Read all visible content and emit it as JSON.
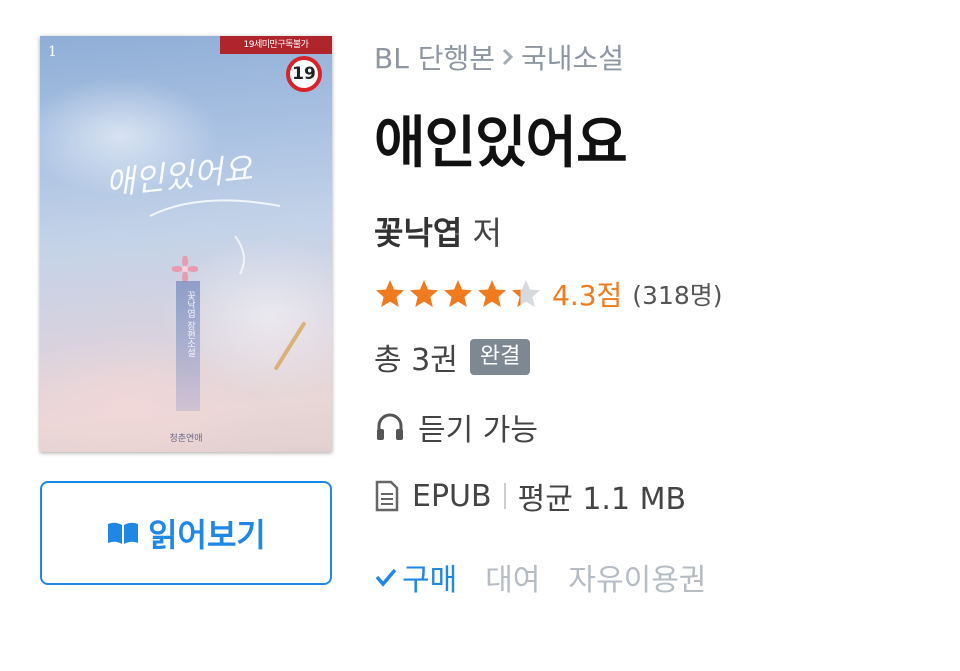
{
  "cover": {
    "volume_mark": "1",
    "banner_text": "19세미만구독불가",
    "age_rating": "19",
    "title_script": "애인있어요",
    "ribbon_text": "꽃낙엽 장편소설",
    "publisher": "청춘연애"
  },
  "read_button": {
    "label": "읽어보기",
    "icon": "open-book-icon"
  },
  "breadcrumb": {
    "category": "BL 단행본",
    "separator_icon": "chevron-right-icon",
    "subcategory": "국내소설"
  },
  "book": {
    "title": "애인있어요",
    "author": "꽃낙엽",
    "author_suffix": "저",
    "rating": {
      "stars": 4.3,
      "max": 5,
      "score_text": "4.3점",
      "count_text": "(318명)",
      "star_color": "#f07a1e"
    },
    "volumes_text": "총 3권",
    "status_badge": "완결",
    "audio_text": "듣기 가능",
    "format": "EPUB",
    "size_text": "평균 1.1 MB"
  },
  "purchase_tabs": [
    {
      "label": "구매",
      "active": true
    },
    {
      "label": "대여",
      "active": false
    },
    {
      "label": "자유이용권",
      "active": false
    }
  ],
  "colors": {
    "accent": "#1f87e5",
    "star": "#f07a1e",
    "badge": "#7d8892"
  }
}
